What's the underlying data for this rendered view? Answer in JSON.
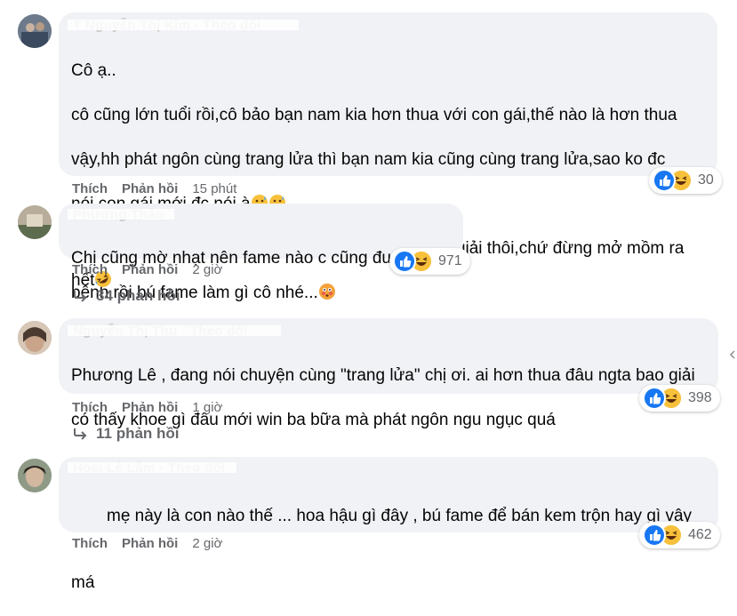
{
  "comments": [
    {
      "author": "T  Nguyễn Thị Kim  ·  Theo dõi",
      "lines": [
        "Cô ạ..",
        "cô cũng lớn tuổi rồi,cô bảo bạn nam kia hơn thua với con gái,thế nào là hơn thua",
        "vậy,hh phát ngôn cùng trang lửa thì bạn nam kia cũng cùng trang lửa,sao ko đc",
        "nói,con gái mới đc nói à",
        "Thôi cô bằng tuổi cha tuổi mẹ lên đứng ở giữa hoà giải thôi,chứ đừng mở mồm ra",
        "bênh rồi bú fame làm gì cô nhé..."
      ],
      "like_label": "Thích",
      "reply_label": "Phản hồi",
      "time": "15 phút",
      "reaction_count": "30"
    },
    {
      "author": "Phương Thảo",
      "lines": [
        "Chị cũng mờ nhạt nên fame nào c cũng đu đeo hết"
      ],
      "like_label": "Thích",
      "reply_label": "Phản hồi",
      "time": "2 giờ",
      "reaction_count": "971",
      "replies_label": "34 phản hồi"
    },
    {
      "author": "Nguyễn Thị Thu  ·  Theo dõi",
      "lines": [
        "Phương Lê , đang nói chuyện cùng \"trang lửa\" chị ơi. ai hơn thua đâu ngta bao giải",
        "có thấy khoe gì đâu mới win ba bữa mà phát ngôn ngu ngục quá"
      ],
      "like_label": "Thích",
      "reply_label": "Phản hồi",
      "time": "1 giờ",
      "reaction_count": "398",
      "replies_label": "11 phản hồi"
    },
    {
      "author": "Hoài Lê Lâm  ·  Theo dõi",
      "lines": [
        "mẹ này là con nào thế ... hoa hậu gì đây , bú fame để bán kem trộn hay gì vậy",
        "má"
      ],
      "like_label": "Thích",
      "reply_label": "Phản hồi",
      "time": "2 giờ",
      "reaction_count": "462"
    }
  ],
  "colors": {
    "bubble": "#f0f2f5",
    "meta_text": "#65676b",
    "like_blue": "#1877f2",
    "haha_yellow": "#f7c13b"
  },
  "icons": [
    "like-icon",
    "haha-icon",
    "reply-arrow-icon",
    "grinning-sweat-emoji",
    "flushed-emoji",
    "rofl-emoji"
  ]
}
